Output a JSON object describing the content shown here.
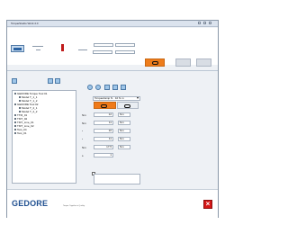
{
  "window": {
    "title": "TorqueStudio Work 4.0"
  },
  "footer": {
    "brand": "GEDORE",
    "subtext": "Torque. Together in Quality."
  },
  "tree": {
    "items": [
      "GEDORE Torque Tool 01",
      "Model T_1_1",
      "Model T_1_2",
      "GEDORE Tool 02",
      "Model T_2_1",
      "Model T_2_2",
      "TTM_01",
      "TMT_02",
      "TMT_Line_01",
      "TMT_Line_02",
      "Test_04",
      "Test_01"
    ]
  },
  "form": {
    "mode": "Torqueclamp N · 10 N·m",
    "action_active": "tool",
    "action_other": "tool-other",
    "rows": [
      {
        "label": "Nm",
        "value": "12",
        "unit": "Nm"
      },
      {
        "label": "Nm",
        "value": "11",
        "unit": "Nm"
      },
      {
        "label": "°",
        "value": "10",
        "unit": "Nm"
      },
      {
        "label": "°",
        "value": "11",
        "unit": "Nm"
      },
      {
        "label": "Nm",
        "value": "17.5",
        "unit": "Nm"
      },
      {
        "label": "s",
        "value": "1",
        "unit": ""
      }
    ]
  },
  "colors": {
    "accent": "#ee7d1c",
    "brand": "#1f4f90",
    "danger": "#d51717"
  }
}
